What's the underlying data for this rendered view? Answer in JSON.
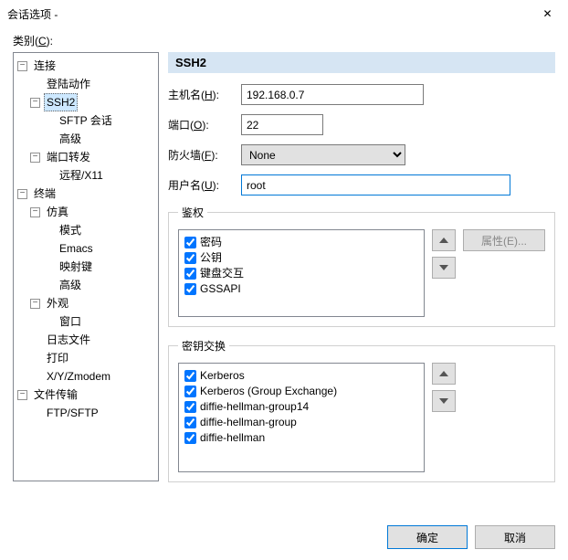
{
  "window": {
    "title": "会话选项 -",
    "close_glyph": "✕"
  },
  "category_label_prefix": "类别(",
  "category_label_key": "C",
  "category_label_suffix": "):",
  "tree": {
    "n0": "连接",
    "n0_0": "登陆动作",
    "n0_1": "SSH2",
    "n0_1_0": "SFTP 会话",
    "n0_1_1": "高级",
    "n0_2": "端口转发",
    "n0_2_0": "远程/X11",
    "n1": "终端",
    "n1_0": "仿真",
    "n1_0_0": "模式",
    "n1_0_1": "Emacs",
    "n1_0_2": "映射键",
    "n1_0_3": "高级",
    "n1_1": "外观",
    "n1_1_0": "窗口",
    "n1_2": "日志文件",
    "n1_3": "打印",
    "n1_4": "X/Y/Zmodem",
    "n2": "文件传输",
    "n2_0": "FTP/SFTP"
  },
  "header": "SSH2",
  "labels": {
    "host_pre": "主机名(",
    "host_key": "H",
    "host_suf": "):",
    "port_pre": "端口(",
    "port_key": "O",
    "port_suf": "):",
    "fw_pre": "防火墙(",
    "fw_key": "F",
    "fw_suf": "):",
    "user_pre": "用户名(",
    "user_key": "U",
    "user_suf": "):"
  },
  "values": {
    "host": "192.168.0.7",
    "port": "22",
    "firewall": "None",
    "user": "root"
  },
  "auth": {
    "legend": "鉴权",
    "items": [
      "密码",
      "公钥",
      "键盘交互",
      "GSSAPI"
    ],
    "properties_label": "属性(E)..."
  },
  "kex": {
    "legend": "密钥交换",
    "items": [
      "Kerberos",
      "Kerberos (Group Exchange)",
      "diffie-hellman-group14",
      "diffie-hellman-group",
      "diffie-hellman"
    ]
  },
  "buttons": {
    "ok": "确定",
    "cancel": "取消"
  },
  "glyph": {
    "minus": "−"
  }
}
